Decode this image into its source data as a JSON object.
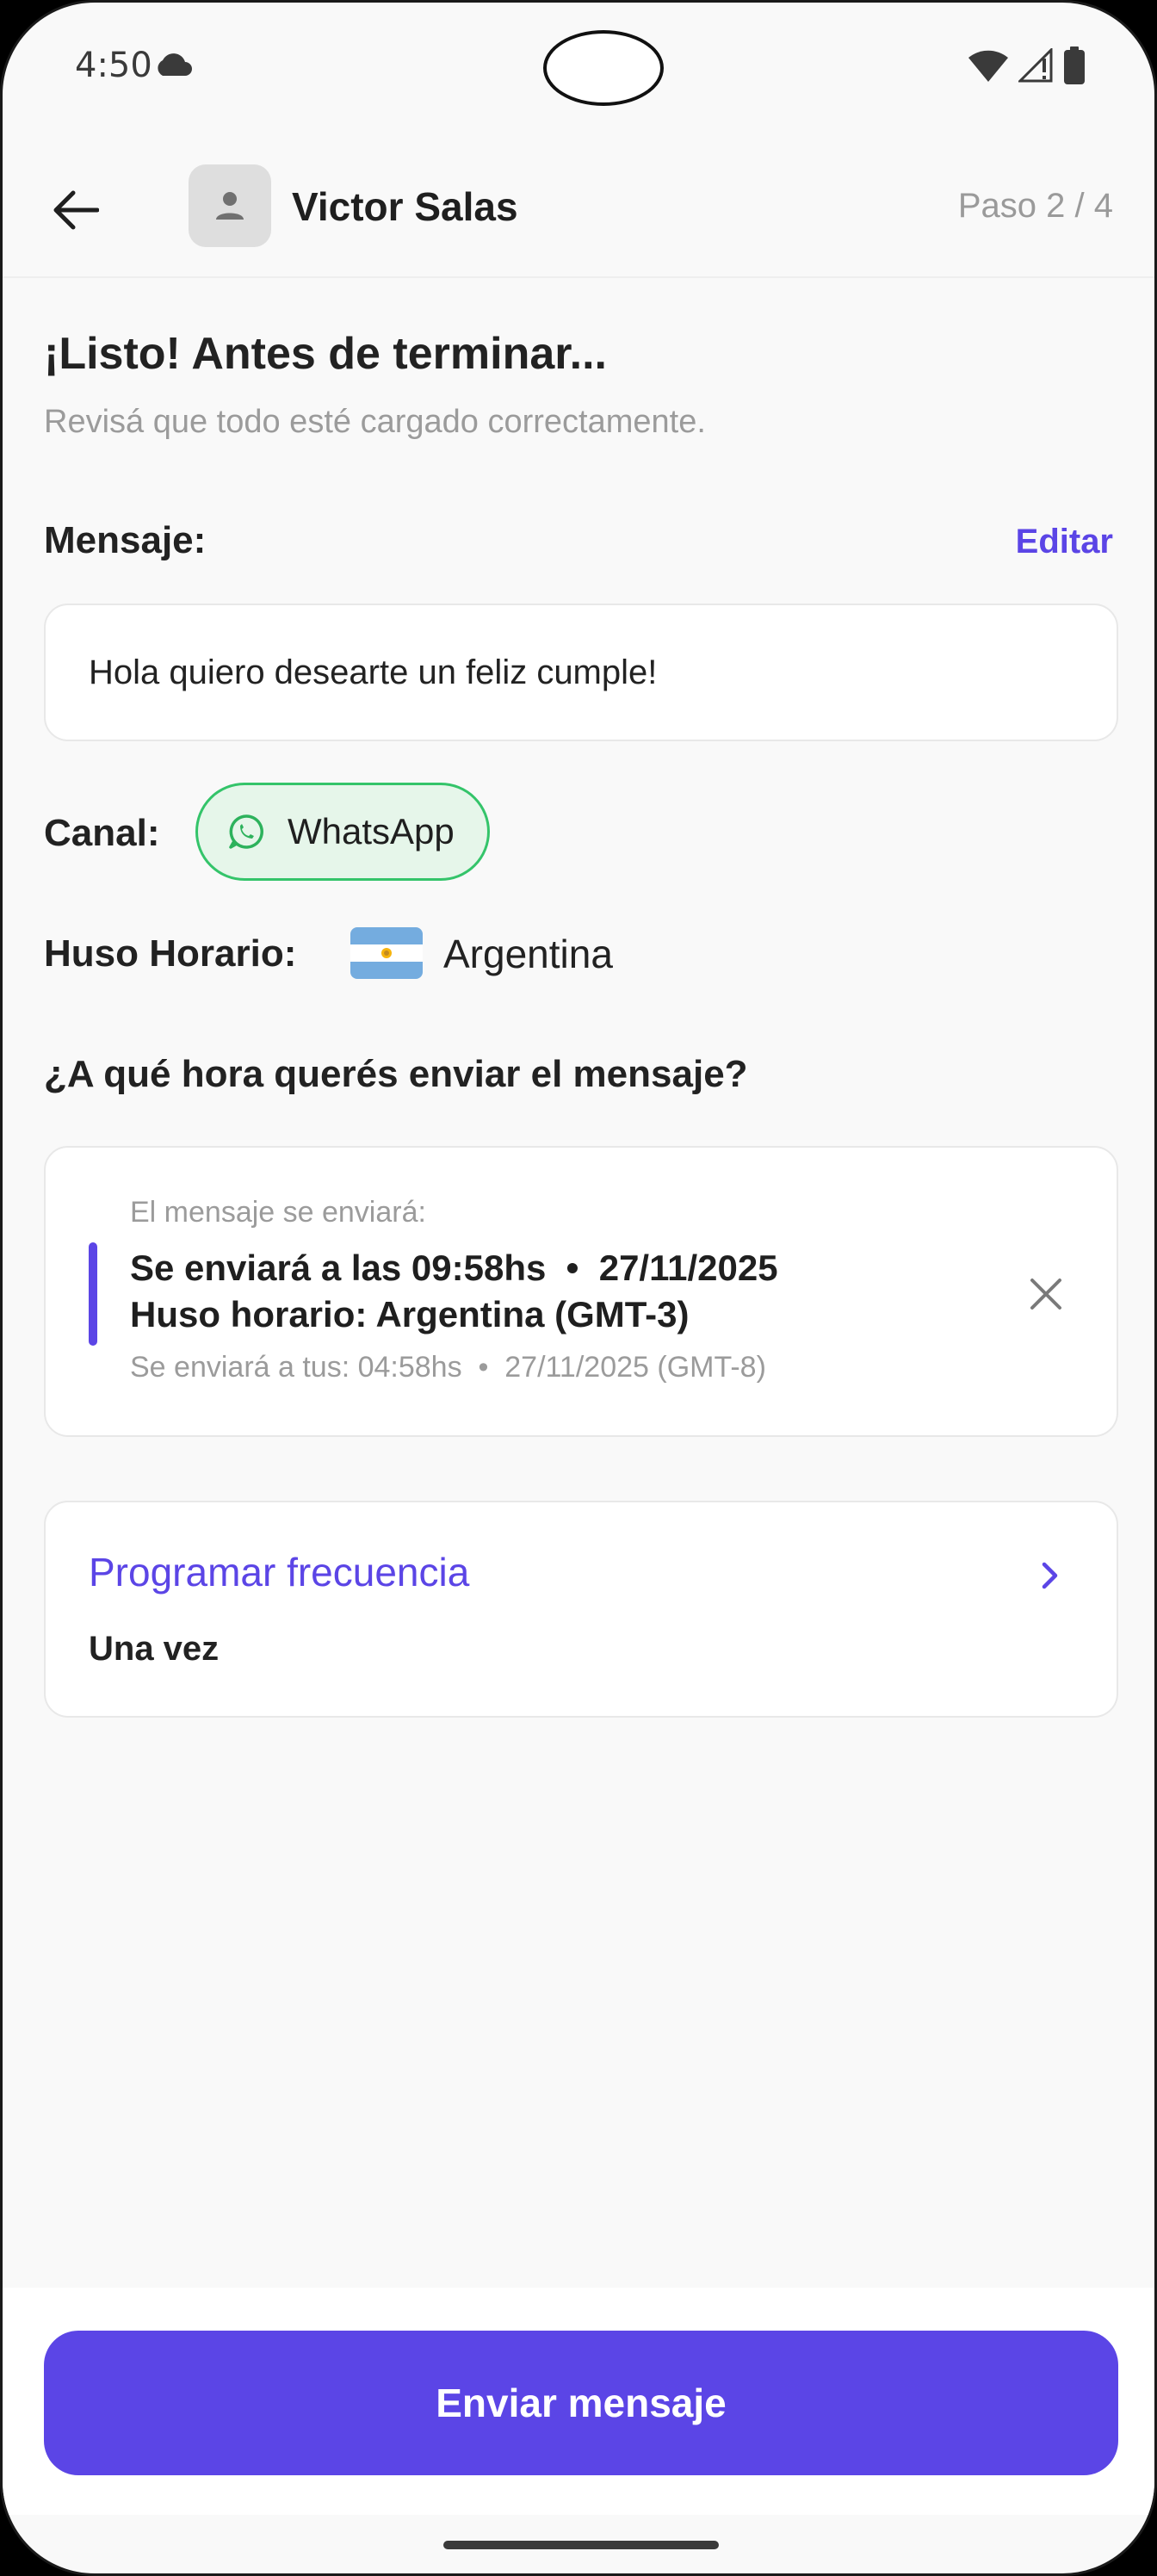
{
  "status_bar": {
    "time": "4:50",
    "icons": [
      "cloud-icon",
      "wifi-icon",
      "signal-icon",
      "battery-icon"
    ]
  },
  "header": {
    "contact_name": "Victor Salas",
    "step": "Paso 2 / 4"
  },
  "content": {
    "title": "¡Listo! Antes de terminar...",
    "subtitle": "Revisá que todo esté cargado correctamente.",
    "message_label": "Mensaje:",
    "edit_label": "Editar",
    "message_text": "Hola quiero desearte un feliz cumple!",
    "channel_label": "Canal:",
    "channel_value": "WhatsApp",
    "timezone_label": "Huso Horario:",
    "timezone_value": "Argentina",
    "question": "¿A qué hora querés enviar el mensaje?"
  },
  "schedule": {
    "caption": "El mensaje se enviará:",
    "line1": "Se enviará a las 09:58hs  •  27/11/2025",
    "line2": "Huso horario: Argentina (GMT-3)",
    "local": "Se enviará a tus: 04:58hs  •  27/11/2025 (GMT-8)"
  },
  "frequency": {
    "title": "Programar frecuencia",
    "value": "Una vez"
  },
  "actions": {
    "send_label": "Enviar mensaje"
  },
  "colors": {
    "accent": "#5b45e6",
    "whatsapp_green": "#34c46a",
    "whatsapp_bg": "#e6f6ea"
  }
}
